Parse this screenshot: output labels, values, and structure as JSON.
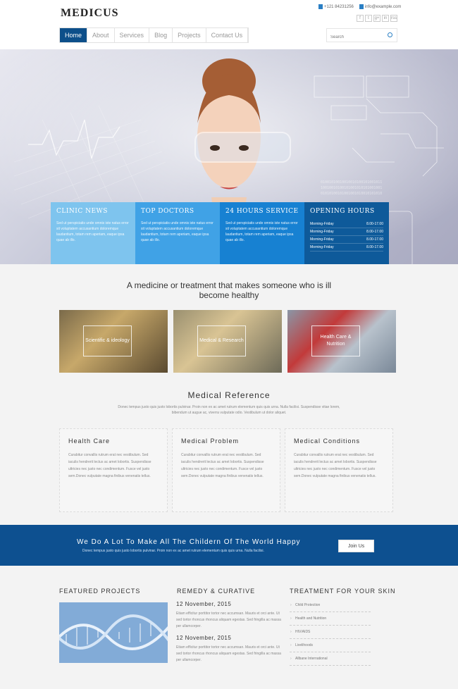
{
  "brand": {
    "logo": "MEDICUS"
  },
  "contact": {
    "phone": "+121 84231256",
    "email": "info@example.com"
  },
  "social": [
    "f",
    "t",
    "g+",
    "in",
    "rss"
  ],
  "nav": {
    "items": [
      "Home",
      "About",
      "Services",
      "Blog",
      "Projects",
      "Contact Us"
    ],
    "active": "Home"
  },
  "search": {
    "placeholder": "Search"
  },
  "info_boxes": [
    {
      "title": "CLINIC NEWS",
      "text": "Sed ut perspiciatis unde omnis iste natus error sit voluptatem accusantium doloremque laudantium, totam rem aperiam, eaque ipsa quae ab illo."
    },
    {
      "title": "TOP DOCTORS",
      "text": "Sed ut perspiciatis unde omnis iste natus error sit voluptatem accusantium doloremque laudantium, totam rem aperiam, eaque ipsa quae ab illo."
    },
    {
      "title": "24 HOURS SERVICE",
      "text": "Sed ut perspiciatis unde omnis iste natus error sit voluptatem accusantium doloremque laudantium, totam rem aperiam, eaque ipsa quae ab illo."
    }
  ],
  "opening_hours": {
    "title": "OPENING HOURS",
    "rows": [
      {
        "day": "Morning-Friday",
        "time": "8.00-17.00"
      },
      {
        "day": "Morning-Friday",
        "time": "8.00-17.00"
      },
      {
        "day": "Morning-Friday",
        "time": "8.00-17.00"
      },
      {
        "day": "Morning-Friday",
        "time": "8.00-17.00"
      }
    ]
  },
  "tagline": "A medicine or treatment that makes someone who is ill become healthy",
  "thumbs": [
    "Scientific & ideology",
    "Medical & Research",
    "Health Care & Nutrition"
  ],
  "reference": {
    "title": "Medical Reference",
    "text": "Donec tempus justo quis justo lobortis pulvinar. Proin non ex ac amet rutrum elementum quis quis urna. Nulla facilisi. Suspendisse vitae lorem, bibendum ut augue ac, viverra vulputate odio. Vestibulum ut dolor aliquet."
  },
  "cards": [
    {
      "title": "Health Care",
      "text": "Curabitur convallis rutrum erat nec vestibulum. Sed iaculis hendrerit lectus ac amet lobortis. Suspendisse ultricies nec justo nec condimentum. Fusce vel justo sem.Donec vulputate magna finibus venenatis tellus."
    },
    {
      "title": "Medical Problem",
      "text": "Curabitur convallis rutrum erat nec vestibulum. Sed iaculis hendrerit lectus ac amet lobortis. Suspendisse ultricies nec justo nec condimentum. Fusce vel justo sem.Donec vulputate magna finibus venenatis tellus."
    },
    {
      "title": "Medical Conditions",
      "text": "Curabitur convallis rutrum erat nec vestibulum. Sed iaculis hendrerit lectus ac amet lobortis. Suspendisse ultricies nec justo nec condimentum. Fusce vel justo sem.Donec vulputate magna finibus venenatis tellus."
    }
  ],
  "banner": {
    "title": "We Do A Lot To Make All The Childern Of The World Happy",
    "text": "Donec tempus justo quis justo lobortis pulvinar. Proin non ex ac amet rutrum elementum quis quis urna. Nulla facilisi.",
    "button": "Join Us"
  },
  "featured": {
    "title": "FEATURED PROJECTS"
  },
  "remedy": {
    "title": "REMEDY & CURATIVE",
    "posts": [
      {
        "date": "12 November, 2015",
        "text": "Etiam efficitur porttitor tortor nec accumsan. Mauris et orci ante. Ut sed tortor rhoncus rhoncus aliquam egestas. Sed fringilla ac massa per ullamcorper."
      },
      {
        "date": "12 November, 2015",
        "text": "Etiam efficitur porttitor tortor nec accumsan. Mauris et orci ante. Ut sed tortor rhoncus rhoncus aliquam egestas. Sed fringilla ac massa per ullamcorper."
      }
    ]
  },
  "treatment": {
    "title": "TREATMENT FOR YOUR SKIN",
    "items": [
      "Child Protection",
      "Health and Nutrition",
      "HIV/AIDS",
      "Livelihoods",
      "Allbane International"
    ]
  },
  "colors": {
    "primary": "#0d4f8a",
    "accent": "#2a7fc4",
    "box1": "#7ec4ee",
    "box2": "#40a2e6",
    "box3": "#1781d2",
    "box4": "#0e5a9a"
  }
}
